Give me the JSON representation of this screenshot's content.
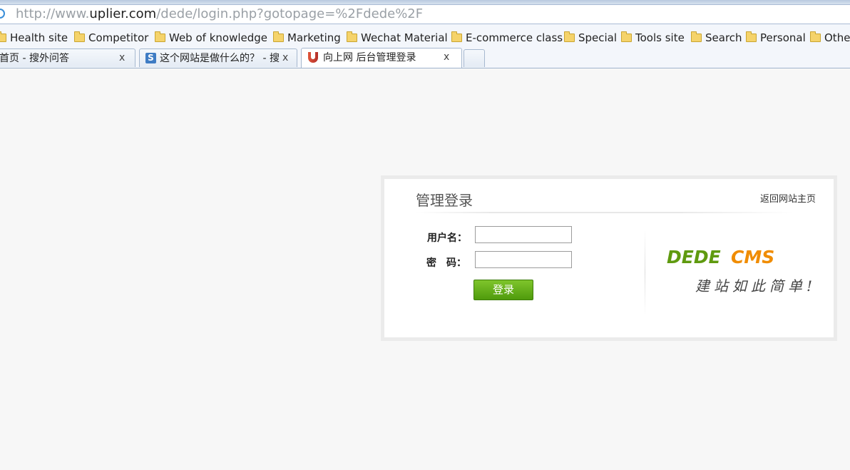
{
  "browser": {
    "address": {
      "prefix": "http://www.",
      "domain": "uplier.com",
      "path": "/dede/login.php?gotopage=%2Fdede%2F"
    },
    "bookmarks": [
      {
        "label": "Health site"
      },
      {
        "label": "Competitor"
      },
      {
        "label": "Web of knowledge"
      },
      {
        "label": "Marketing"
      },
      {
        "label": "Wechat Material"
      },
      {
        "label": "E-commerce class"
      },
      {
        "label": "Special"
      },
      {
        "label": "Tools site"
      },
      {
        "label": "Search"
      },
      {
        "label": "Personal"
      },
      {
        "label": "Other"
      }
    ],
    "tabs": [
      {
        "title": "首页 - 搜外问答",
        "close": "x",
        "active": false
      },
      {
        "title": "这个网站是做什么的？ - 搜",
        "close": "x",
        "active": false,
        "favicon": "S"
      },
      {
        "title": "向上网 后台管理登录",
        "close": "x",
        "active": true
      }
    ]
  },
  "login": {
    "title": "管理登录",
    "back_link": "返回网站主页",
    "username_label": "用户名：",
    "password_label": "密　码：",
    "username_value": "",
    "password_value": "",
    "submit_label": "登录",
    "logo_text": "DEDE CMS",
    "logo_part1": "DEDE",
    "logo_part2": "CMS",
    "slogan": "建站如此简单!",
    "colors": {
      "logo_green": "#5f9a0f",
      "logo_orange": "#f08c00",
      "button_green": "#5aa712"
    }
  }
}
